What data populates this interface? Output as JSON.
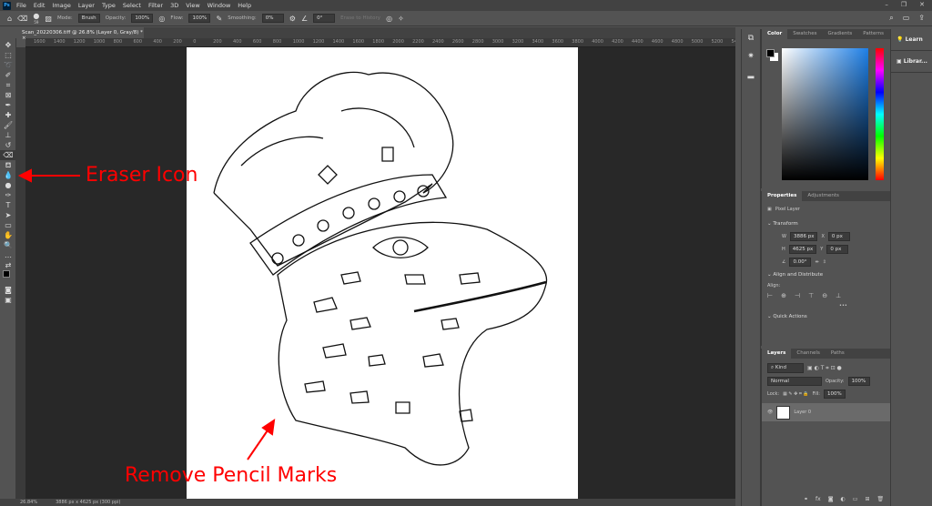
{
  "app": {
    "logo": "Ps",
    "menus": [
      "File",
      "Edit",
      "Image",
      "Layer",
      "Type",
      "Select",
      "Filter",
      "3D",
      "View",
      "Window",
      "Help"
    ]
  },
  "options": {
    "brush_size": "59",
    "mode_label": "Mode:",
    "mode_value": "Brush",
    "opacity_label": "Opacity:",
    "opacity_value": "100%",
    "flow_label": "Flow:",
    "flow_value": "100%",
    "smoothing_label": "Smoothing:",
    "smoothing_value": "0%",
    "angle_value": "0°",
    "erase_to_history": "Erase to History"
  },
  "document": {
    "tab_title": "Scan_20220306.tiff @ 26.8% (Layer 0, Gray/8) *"
  },
  "ruler": {
    "labels": [
      "1600",
      "1400",
      "1200",
      "1000",
      "800",
      "600",
      "400",
      "200",
      "0",
      "200",
      "400",
      "600",
      "800",
      "1000",
      "1200",
      "1400",
      "1600",
      "1800",
      "2000",
      "2200",
      "2400",
      "2600",
      "2800",
      "3000",
      "3200",
      "3400",
      "3600",
      "3800",
      "4000",
      "4200",
      "4400",
      "4600",
      "4800",
      "5000",
      "5200",
      "5400"
    ]
  },
  "status": {
    "zoom": "26.84%",
    "doc_info": "3886 px x 4625 px (300 ppi)"
  },
  "color_panel": {
    "tabs": [
      "Color",
      "Swatches",
      "Gradients",
      "Patterns"
    ]
  },
  "right_strip": {
    "learn": "Learn",
    "libraries": "Librar..."
  },
  "properties": {
    "tabs": [
      "Properties",
      "Adjustments"
    ],
    "type": "Pixel Layer",
    "transform": "Transform",
    "w_label": "W",
    "w": "3886 px",
    "h_label": "H",
    "h": "4625 px",
    "x_label": "X",
    "x": "0 px",
    "y_label": "Y",
    "y": "0 px",
    "angle": "0.00°",
    "align_header": "Align and Distribute",
    "align_label": "Align:",
    "quick_actions": "Quick Actions"
  },
  "layers": {
    "tabs": [
      "Layers",
      "Channels",
      "Paths"
    ],
    "filter": "Kind",
    "blend": "Normal",
    "opacity_label": "Opacity:",
    "opacity": "100%",
    "lock_label": "Lock:",
    "fill_label": "Fill:",
    "fill": "100%",
    "items": [
      {
        "name": "Layer 0"
      }
    ]
  },
  "annotations": {
    "eraser": "Eraser Icon",
    "pencil": "Remove Pencil Marks",
    "color": "#ff0000"
  }
}
